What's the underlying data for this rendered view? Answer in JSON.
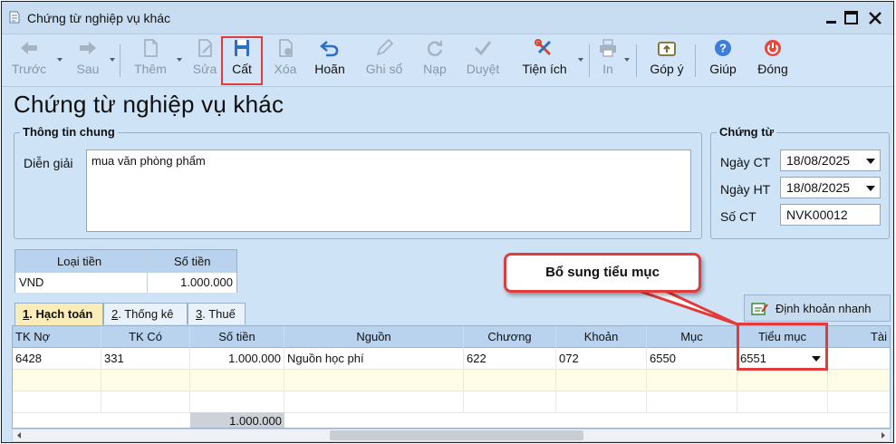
{
  "window": {
    "title": "Chứng từ nghiệp vụ khác"
  },
  "toolbar": {
    "buttons": [
      {
        "label": "Trước",
        "icon": "arrow-left-icon",
        "enabled": false
      },
      {
        "label": "Sau",
        "icon": "arrow-right-icon",
        "enabled": false
      },
      {
        "label": "Thêm",
        "icon": "new-document-icon",
        "enabled": false
      },
      {
        "label": "Sửa",
        "icon": "edit-document-icon",
        "enabled": false
      },
      {
        "label": "Cất",
        "icon": "save-icon",
        "enabled": true,
        "highlighted": true
      },
      {
        "label": "Xóa",
        "icon": "delete-document-icon",
        "enabled": false
      },
      {
        "label": "Hoãn",
        "icon": "undo-icon",
        "enabled": true
      },
      {
        "label": "Ghi sổ",
        "icon": "pencil-icon",
        "enabled": false
      },
      {
        "label": "Nạp",
        "icon": "refresh-icon",
        "enabled": false
      },
      {
        "label": "Duyệt",
        "icon": "checkmark-icon",
        "enabled": false
      },
      {
        "label": "Tiện ích",
        "icon": "tools-icon",
        "enabled": true
      },
      {
        "label": "In",
        "icon": "printer-icon",
        "enabled": false
      },
      {
        "label": "Góp ý",
        "icon": "feedback-icon",
        "enabled": true
      },
      {
        "label": "Giúp",
        "icon": "help-icon",
        "enabled": true
      },
      {
        "label": "Đóng",
        "icon": "power-icon",
        "enabled": true
      }
    ]
  },
  "page_title": "Chứng từ nghiệp vụ khác",
  "general_info": {
    "legend": "Thông tin chung",
    "description_label": "Diễn giải",
    "description_value": "mua văn phòng phẩm"
  },
  "voucher": {
    "legend": "Chứng từ",
    "date_ct_label": "Ngày CT",
    "date_ct_value": "18/08/2025",
    "date_ht_label": "Ngày HT",
    "date_ht_value": "18/08/2025",
    "number_label": "Số CT",
    "number_value": "NVK00012"
  },
  "currency": {
    "headers": [
      "Loại tiền",
      "Số tiền"
    ],
    "currency_value": "VND",
    "amount_value": "1.000.000"
  },
  "tabs": [
    {
      "num": "1",
      "label": ". Hạch toán",
      "active": true
    },
    {
      "num": "2",
      "label": ". Thống kê",
      "active": false
    },
    {
      "num": "3",
      "label": ". Thuế",
      "active": false
    }
  ],
  "quick_button": {
    "label": "Định khoản nhanh"
  },
  "grid": {
    "headers": [
      "TK Nợ",
      "TK Có",
      "Số tiền",
      "Nguồn",
      "Chương",
      "Khoản",
      "Mục",
      "Tiểu mục",
      "Tài"
    ],
    "rows": [
      {
        "tk_no": "6428",
        "tk_co": "331",
        "so_tien": "1.000.000",
        "nguon": "Nguồn học phí",
        "chuong": "622",
        "khoan": "072",
        "muc": "6550",
        "tieu_muc": "6551"
      }
    ],
    "total": "1.000.000"
  },
  "callout": {
    "text": "Bổ sung tiểu mục"
  },
  "colors": {
    "highlight": "#e23b3b",
    "header_blue": "#b9d3ee",
    "window_bg": "#cfe3f7"
  }
}
